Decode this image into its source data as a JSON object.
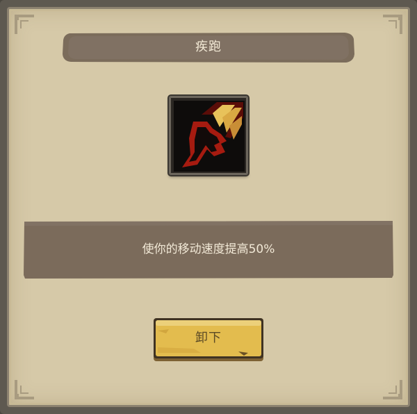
{
  "dialog": {
    "title": "疾跑",
    "skill_icon": "sprint-boot-icon",
    "description": "使你的移动速度提高50%",
    "button_label": "卸下"
  },
  "colors": {
    "panel": "#d6c9a8",
    "banner": "#7d6e5c",
    "button": "#e2bb4c",
    "icon_red": "#a81a10",
    "icon_yellow": "#e8c25a"
  }
}
